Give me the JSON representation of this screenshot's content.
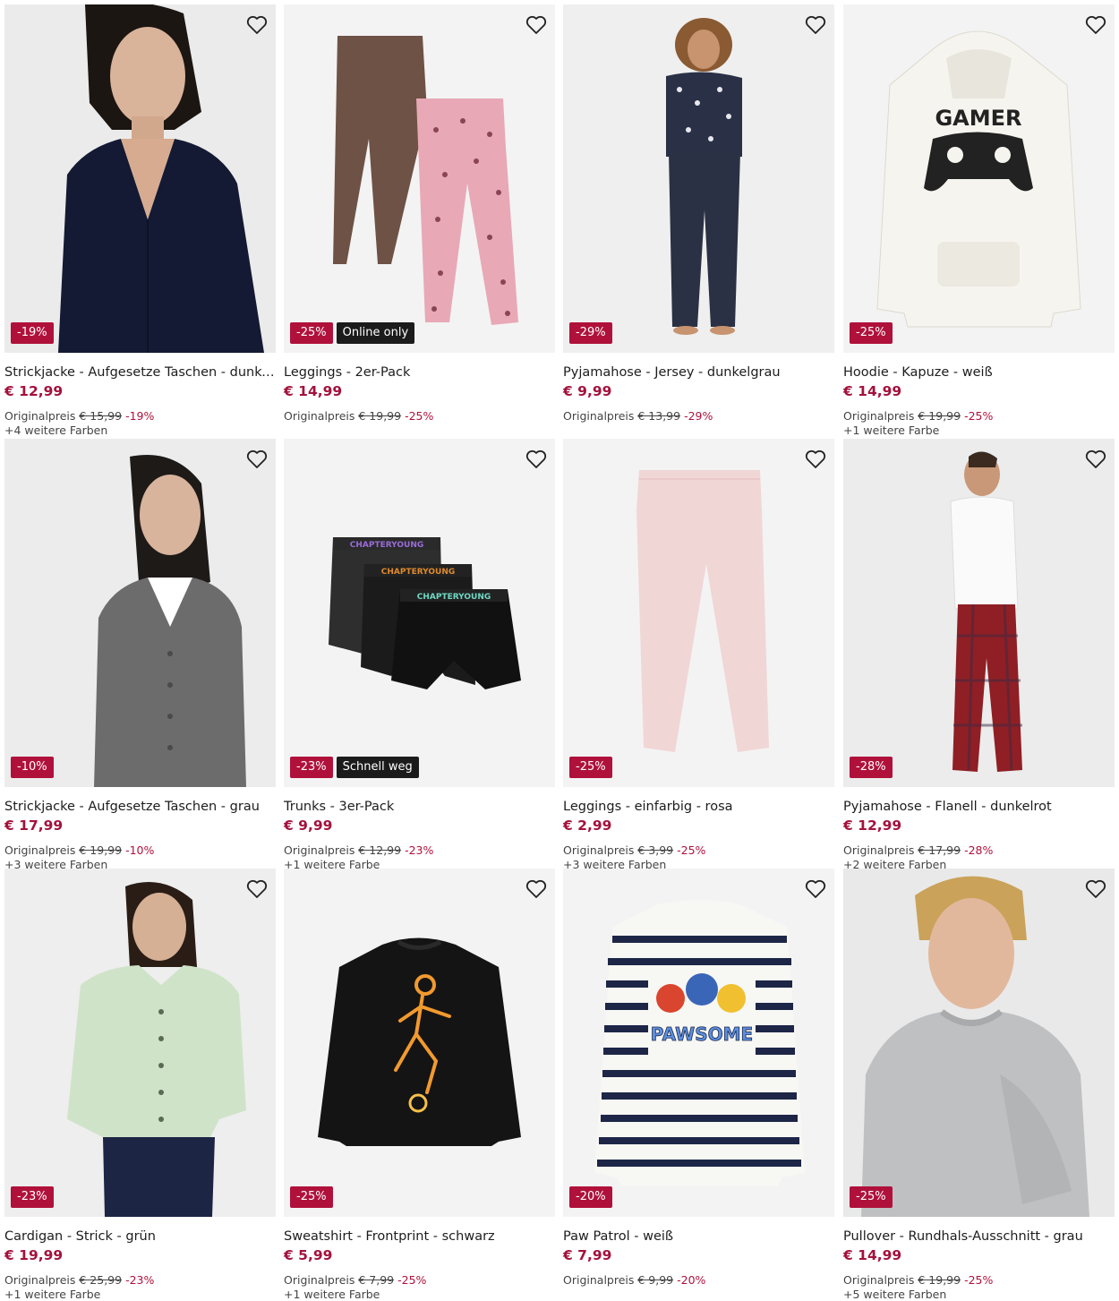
{
  "brand_colors": {
    "price": "#a3123c",
    "discount_badge": "#b0113b",
    "flag_badge": "#1b1b1b"
  },
  "products": [
    {
      "title": "Strickjacke - Aufgesetze Taschen - dunkelblau",
      "price": "€ 12,99",
      "original_label": "Originalpreis",
      "original_price": "€ 15,99",
      "discount": "-19%",
      "badge": "-19%",
      "flag": "",
      "colors": "+4 weitere Farben",
      "favorite_icon": "heart-outline-icon"
    },
    {
      "title": "Leggings - 2er-Pack",
      "price": "€ 14,99",
      "original_label": "Originalpreis",
      "original_price": "€ 19,99",
      "discount": "-25%",
      "badge": "-25%",
      "flag": "Online only",
      "colors": "",
      "favorite_icon": "heart-outline-icon"
    },
    {
      "title": "Pyjamahose - Jersey - dunkelgrau",
      "price": "€ 9,99",
      "original_label": "Originalpreis",
      "original_price": "€ 13,99",
      "discount": "-29%",
      "badge": "-29%",
      "flag": "",
      "colors": "",
      "favorite_icon": "heart-outline-icon"
    },
    {
      "title": "Hoodie - Kapuze - weiß",
      "price": "€ 14,99",
      "original_label": "Originalpreis",
      "original_price": "€ 19,99",
      "discount": "-25%",
      "badge": "-25%",
      "flag": "",
      "colors": "+1 weitere Farbe",
      "favorite_icon": "heart-outline-icon"
    },
    {
      "title": "Strickjacke - Aufgesetze Taschen - grau",
      "price": "€ 17,99",
      "original_label": "Originalpreis",
      "original_price": "€ 19,99",
      "discount": "-10%",
      "badge": "-10%",
      "flag": "",
      "colors": "+3 weitere Farben",
      "favorite_icon": "heart-outline-icon"
    },
    {
      "title": "Trunks - 3er-Pack",
      "price": "€ 9,99",
      "original_label": "Originalpreis",
      "original_price": "€ 12,99",
      "discount": "-23%",
      "badge": "-23%",
      "flag": "Schnell weg",
      "colors": "+1 weitere Farbe",
      "favorite_icon": "heart-outline-icon"
    },
    {
      "title": "Leggings - einfarbig - rosa",
      "price": "€ 2,99",
      "original_label": "Originalpreis",
      "original_price": "€ 3,99",
      "discount": "-25%",
      "badge": "-25%",
      "flag": "",
      "colors": "+3 weitere Farben",
      "favorite_icon": "heart-outline-icon"
    },
    {
      "title": "Pyjamahose - Flanell - dunkelrot",
      "price": "€ 12,99",
      "original_label": "Originalpreis",
      "original_price": "€ 17,99",
      "discount": "-28%",
      "badge": "-28%",
      "flag": "",
      "colors": "+2 weitere Farben",
      "favorite_icon": "heart-outline-icon"
    },
    {
      "title": "Cardigan - Strick - grün",
      "price": "€ 19,99",
      "original_label": "Originalpreis",
      "original_price": "€ 25,99",
      "discount": "-23%",
      "badge": "-23%",
      "flag": "",
      "colors": "+1 weitere Farbe",
      "favorite_icon": "heart-outline-icon"
    },
    {
      "title": "Sweatshirt - Frontprint - schwarz",
      "price": "€ 5,99",
      "original_label": "Originalpreis",
      "original_price": "€ 7,99",
      "discount": "-25%",
      "badge": "-25%",
      "flag": "",
      "colors": "+1 weitere Farbe",
      "favorite_icon": "heart-outline-icon"
    },
    {
      "title": "Paw Patrol - weiß",
      "price": "€ 7,99",
      "original_label": "Originalpreis",
      "original_price": "€ 9,99",
      "discount": "-20%",
      "badge": "-20%",
      "flag": "",
      "colors": "",
      "favorite_icon": "heart-outline-icon"
    },
    {
      "title": "Pullover - Rundhals-Ausschnitt - grau",
      "price": "€ 14,99",
      "original_label": "Originalpreis",
      "original_price": "€ 19,99",
      "discount": "-25%",
      "badge": "-25%",
      "flag": "",
      "colors": "+5 weitere Farben",
      "favorite_icon": "heart-outline-icon"
    }
  ],
  "artwork_text": {
    "hoodie": "GAMER",
    "trunks": "CHAPTERYOUNG",
    "pawpatrol": "PAWSOME"
  }
}
